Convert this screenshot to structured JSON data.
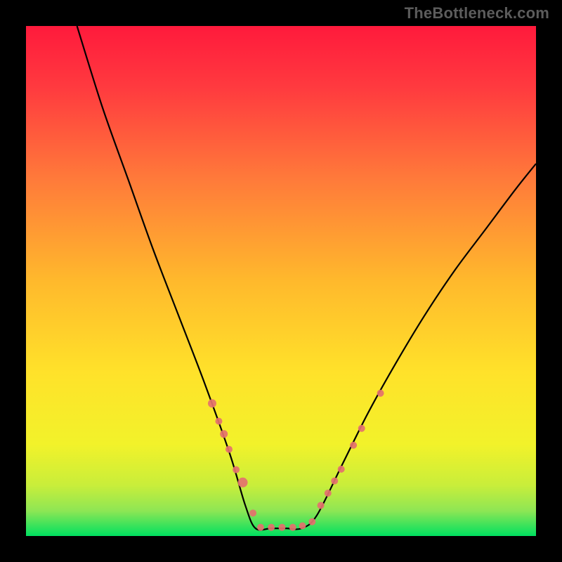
{
  "watermark": "TheBottleneck.com",
  "chart_data": {
    "type": "line",
    "title": "",
    "xlabel": "",
    "ylabel": "",
    "xlim": [
      0,
      100
    ],
    "ylim": [
      0,
      100
    ],
    "grid": false,
    "legend": false,
    "background_gradient_top": "#ff1a3c",
    "background_gradient_mid": "#ffd300",
    "background_gradient_bottom": "#00e060",
    "curve": {
      "description": "V-shaped bottleneck curve; left branch descends from top-left, right branch ascends toward upper-right; trough flattened at bottom",
      "points": [
        {
          "x": 10,
          "y": 100
        },
        {
          "x": 15,
          "y": 84
        },
        {
          "x": 20,
          "y": 70
        },
        {
          "x": 25,
          "y": 56
        },
        {
          "x": 30,
          "y": 43
        },
        {
          "x": 35,
          "y": 30
        },
        {
          "x": 40,
          "y": 16
        },
        {
          "x": 43,
          "y": 6
        },
        {
          "x": 45,
          "y": 1.5
        },
        {
          "x": 48,
          "y": 1.5
        },
        {
          "x": 51,
          "y": 1.5
        },
        {
          "x": 54,
          "y": 1.5
        },
        {
          "x": 57,
          "y": 4
        },
        {
          "x": 62,
          "y": 14
        },
        {
          "x": 67,
          "y": 24
        },
        {
          "x": 72,
          "y": 33
        },
        {
          "x": 78,
          "y": 43
        },
        {
          "x": 84,
          "y": 52
        },
        {
          "x": 90,
          "y": 60
        },
        {
          "x": 96,
          "y": 68
        },
        {
          "x": 100,
          "y": 73
        }
      ]
    },
    "markers": [
      {
        "x": 36.5,
        "y": 26,
        "r": 6
      },
      {
        "x": 37.8,
        "y": 22.5,
        "r": 5
      },
      {
        "x": 38.8,
        "y": 20,
        "r": 5.5
      },
      {
        "x": 39.8,
        "y": 17,
        "r": 5
      },
      {
        "x": 41.2,
        "y": 13,
        "r": 5
      },
      {
        "x": 42.5,
        "y": 10.5,
        "r": 7
      },
      {
        "x": 44.5,
        "y": 4.5,
        "r": 5
      },
      {
        "x": 46,
        "y": 1.7,
        "r": 5
      },
      {
        "x": 48.1,
        "y": 1.7,
        "r": 5
      },
      {
        "x": 50.2,
        "y": 1.7,
        "r": 5
      },
      {
        "x": 52.3,
        "y": 1.7,
        "r": 5
      },
      {
        "x": 54.2,
        "y": 2.0,
        "r": 5
      },
      {
        "x": 56.1,
        "y": 2.8,
        "r": 5
      },
      {
        "x": 57.8,
        "y": 6,
        "r": 5
      },
      {
        "x": 59.2,
        "y": 8.4,
        "r": 5
      },
      {
        "x": 60.5,
        "y": 10.8,
        "r": 5
      },
      {
        "x": 61.8,
        "y": 13.1,
        "r": 5
      },
      {
        "x": 64.2,
        "y": 17.8,
        "r": 5
      },
      {
        "x": 65.8,
        "y": 21.1,
        "r": 5
      },
      {
        "x": 69.5,
        "y": 28,
        "r": 5
      }
    ],
    "colors": {
      "curve_stroke": "#000000",
      "marker_fill": "#e4716e"
    }
  }
}
